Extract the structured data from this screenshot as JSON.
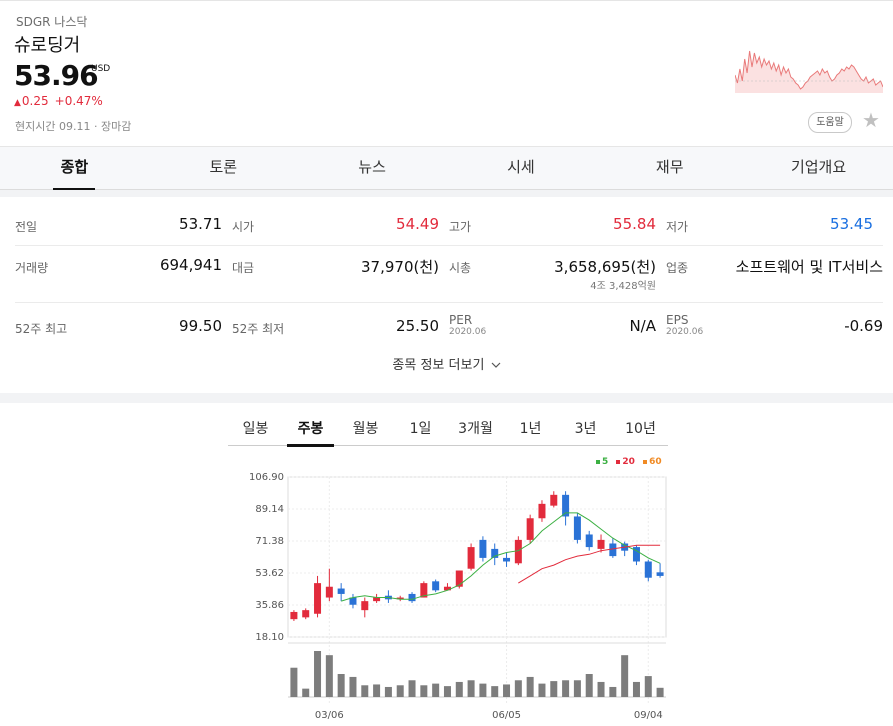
{
  "stock": {
    "exchange": "SDGR 나스닥",
    "name": "슈로딩거",
    "price": "53.96",
    "currency": "USD",
    "change_arrow": "▲",
    "change": "0.25",
    "change_pct": "+0.47%",
    "time_info": "현지시간 09.11 · 장마감",
    "help_label": "도움말",
    "favorite_icon": "★"
  },
  "tabs": [
    "종합",
    "토론",
    "뉴스",
    "시세",
    "재무",
    "기업개요"
  ],
  "info": {
    "row1": [
      {
        "label": "전일",
        "value": "53.71",
        "color": "default"
      },
      {
        "label": "시가",
        "value": "54.49",
        "color": "red"
      },
      {
        "label": "고가",
        "value": "55.84",
        "color": "red"
      },
      {
        "label": "저가",
        "value": "53.45",
        "color": "blue"
      }
    ],
    "row2": [
      {
        "label": "거래량",
        "value": "694,941"
      },
      {
        "label": "대금",
        "value": "37,970(천)"
      },
      {
        "label": "시총",
        "value": "3,658,695(천)",
        "sub": "4조 3,428억원"
      },
      {
        "label": "업종",
        "value": "소프트웨어 및 IT서비스"
      }
    ],
    "row3": [
      {
        "label": "52주 최고",
        "value": "99.50"
      },
      {
        "label": "52주 최저",
        "value": "25.50"
      },
      {
        "label": "PER",
        "sublabel": "2020.06",
        "value": "N/A"
      },
      {
        "label": "EPS",
        "sublabel": "2020.06",
        "value": "-0.69"
      }
    ],
    "more": "종목 정보 더보기"
  },
  "chart_tabs": [
    "일봉",
    "주봉",
    "월봉",
    "1일",
    "3개월",
    "1년",
    "3년",
    "10년"
  ],
  "chart_legend": [
    {
      "label": "5",
      "color": "#3cb043"
    },
    {
      "label": "20",
      "color": "#e22b3c"
    },
    {
      "label": "60",
      "color": "#f08a24"
    }
  ],
  "colors": {
    "up": "#e22b3c",
    "down": "#2a72d6",
    "accent": "#111111"
  },
  "chart_data": {
    "type": "candlestick",
    "ylim": [
      18.1,
      106.9
    ],
    "y_ticks": [
      "106.90",
      "89.14",
      "71.38",
      "53.62",
      "35.86",
      "18.10"
    ],
    "x_ticks": [
      "03/06",
      "06/05",
      "09/04"
    ],
    "candles": [
      {
        "o": 28,
        "c": 32,
        "h": 33,
        "l": 27
      },
      {
        "o": 29,
        "c": 33,
        "h": 34,
        "l": 28
      },
      {
        "o": 31,
        "c": 48,
        "h": 52,
        "l": 29
      },
      {
        "o": 40,
        "c": 46,
        "h": 56,
        "l": 38
      },
      {
        "o": 45,
        "c": 42,
        "h": 48,
        "l": 38
      },
      {
        "o": 40,
        "c": 36,
        "h": 42,
        "l": 34
      },
      {
        "o": 33,
        "c": 38,
        "h": 40,
        "l": 29
      },
      {
        "o": 38,
        "c": 40,
        "h": 42,
        "l": 37
      },
      {
        "o": 41,
        "c": 39,
        "h": 44,
        "l": 37
      },
      {
        "o": 39,
        "c": 40,
        "h": 41,
        "l": 38
      },
      {
        "o": 42,
        "c": 38,
        "h": 43,
        "l": 37
      },
      {
        "o": 40,
        "c": 48,
        "h": 49,
        "l": 40
      },
      {
        "o": 49,
        "c": 44,
        "h": 50,
        "l": 43
      },
      {
        "o": 44,
        "c": 46,
        "h": 48,
        "l": 44
      },
      {
        "o": 46,
        "c": 55,
        "h": 55,
        "l": 45
      },
      {
        "o": 56,
        "c": 68,
        "h": 70,
        "l": 55
      },
      {
        "o": 72,
        "c": 62,
        "h": 74,
        "l": 60
      },
      {
        "o": 67,
        "c": 62,
        "h": 70,
        "l": 58
      },
      {
        "o": 62,
        "c": 60,
        "h": 65,
        "l": 57
      },
      {
        "o": 59,
        "c": 72,
        "h": 74,
        "l": 58
      },
      {
        "o": 72,
        "c": 84,
        "h": 86,
        "l": 70
      },
      {
        "o": 84,
        "c": 92,
        "h": 94,
        "l": 82
      },
      {
        "o": 91,
        "c": 97,
        "h": 99,
        "l": 90
      },
      {
        "o": 97,
        "c": 85,
        "h": 99,
        "l": 80
      },
      {
        "o": 85,
        "c": 72,
        "h": 87,
        "l": 70
      },
      {
        "o": 75,
        "c": 68,
        "h": 77,
        "l": 66
      },
      {
        "o": 67,
        "c": 72,
        "h": 75,
        "l": 65
      },
      {
        "o": 70,
        "c": 63,
        "h": 73,
        "l": 62
      },
      {
        "o": 70,
        "c": 66,
        "h": 71,
        "l": 63
      },
      {
        "o": 68,
        "c": 60,
        "h": 69,
        "l": 58
      },
      {
        "o": 60,
        "c": 51,
        "h": 61,
        "l": 49
      },
      {
        "o": 54,
        "c": 52,
        "h": 59,
        "l": 51
      }
    ],
    "ma5": [
      null,
      null,
      null,
      null,
      38,
      40,
      41,
      40,
      40,
      39,
      39,
      41,
      42,
      44,
      47,
      52,
      58,
      63,
      65,
      66,
      70,
      77,
      82,
      87,
      87,
      83,
      78,
      73,
      69,
      66,
      62,
      59
    ],
    "ma20": [
      null,
      null,
      null,
      null,
      null,
      null,
      null,
      null,
      null,
      null,
      null,
      null,
      null,
      null,
      null,
      null,
      null,
      null,
      null,
      48,
      52,
      56,
      58,
      61,
      63,
      64,
      66,
      67,
      68,
      69,
      69,
      69
    ],
    "volume": [
      70,
      20,
      110,
      100,
      55,
      48,
      28,
      30,
      24,
      28,
      40,
      28,
      32,
      26,
      36,
      40,
      32,
      26,
      30,
      40,
      48,
      32,
      38,
      40,
      40,
      55,
      36,
      24,
      100,
      36,
      50,
      22
    ]
  }
}
